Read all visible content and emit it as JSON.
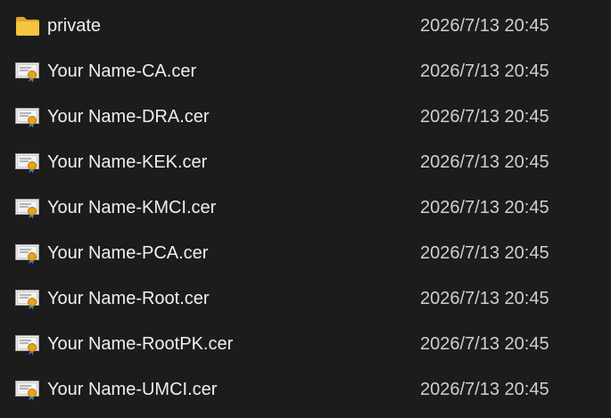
{
  "colors": {
    "background": "#1c1c1c",
    "folder": "#f5c542",
    "certificate_paper": "#f2f2f2",
    "certificate_seal": "#e8a318",
    "certificate_ribbon": "#3a7bd5"
  },
  "files": [
    {
      "name": "private",
      "date": "2026/7/13 20:45",
      "icon": "folder-icon"
    },
    {
      "name": "Your Name-CA.cer",
      "date": "2026/7/13 20:45",
      "icon": "certificate-icon"
    },
    {
      "name": "Your Name-DRA.cer",
      "date": "2026/7/13 20:45",
      "icon": "certificate-icon"
    },
    {
      "name": "Your Name-KEK.cer",
      "date": "2026/7/13 20:45",
      "icon": "certificate-icon"
    },
    {
      "name": "Your Name-KMCI.cer",
      "date": "2026/7/13 20:45",
      "icon": "certificate-icon"
    },
    {
      "name": "Your Name-PCA.cer",
      "date": "2026/7/13 20:45",
      "icon": "certificate-icon"
    },
    {
      "name": "Your Name-Root.cer",
      "date": "2026/7/13 20:45",
      "icon": "certificate-icon"
    },
    {
      "name": "Your Name-RootPK.cer",
      "date": "2026/7/13 20:45",
      "icon": "certificate-icon"
    },
    {
      "name": "Your Name-UMCI.cer",
      "date": "2026/7/13 20:45",
      "icon": "certificate-icon"
    }
  ]
}
